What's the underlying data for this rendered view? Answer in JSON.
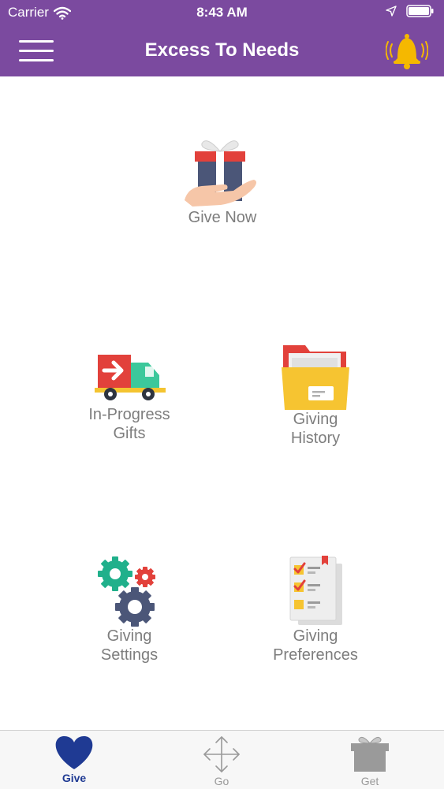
{
  "status_bar": {
    "carrier": "Carrier",
    "time": "8:43 AM"
  },
  "header": {
    "title": "Excess To Needs",
    "background_color": "#7b4a9f",
    "menu_icon": "hamburger-menu-icon",
    "notification_icon": "bell-ringing-icon",
    "bell_color": "#f5b800"
  },
  "dashboard": {
    "give_now": {
      "label": "Give Now",
      "icon": "gift-in-hand-icon"
    },
    "in_progress": {
      "label": "In-Progress\nGifts",
      "icon": "delivery-truck-icon"
    },
    "giving_history": {
      "label": "Giving\nHistory",
      "icon": "folder-icon"
    },
    "giving_settings": {
      "label": "Giving\nSettings",
      "icon": "gears-icon"
    },
    "giving_preferences": {
      "label": "Giving\nPreferences",
      "icon": "checklist-icon"
    }
  },
  "tab_bar": {
    "tabs": [
      {
        "label": "Give",
        "icon": "heart-icon",
        "active": true
      },
      {
        "label": "Go",
        "icon": "move-arrows-icon",
        "active": false
      },
      {
        "label": "Get",
        "icon": "gift-box-icon",
        "active": false
      }
    ],
    "active_color": "#1f3a93",
    "inactive_color": "#9a9a9a"
  }
}
